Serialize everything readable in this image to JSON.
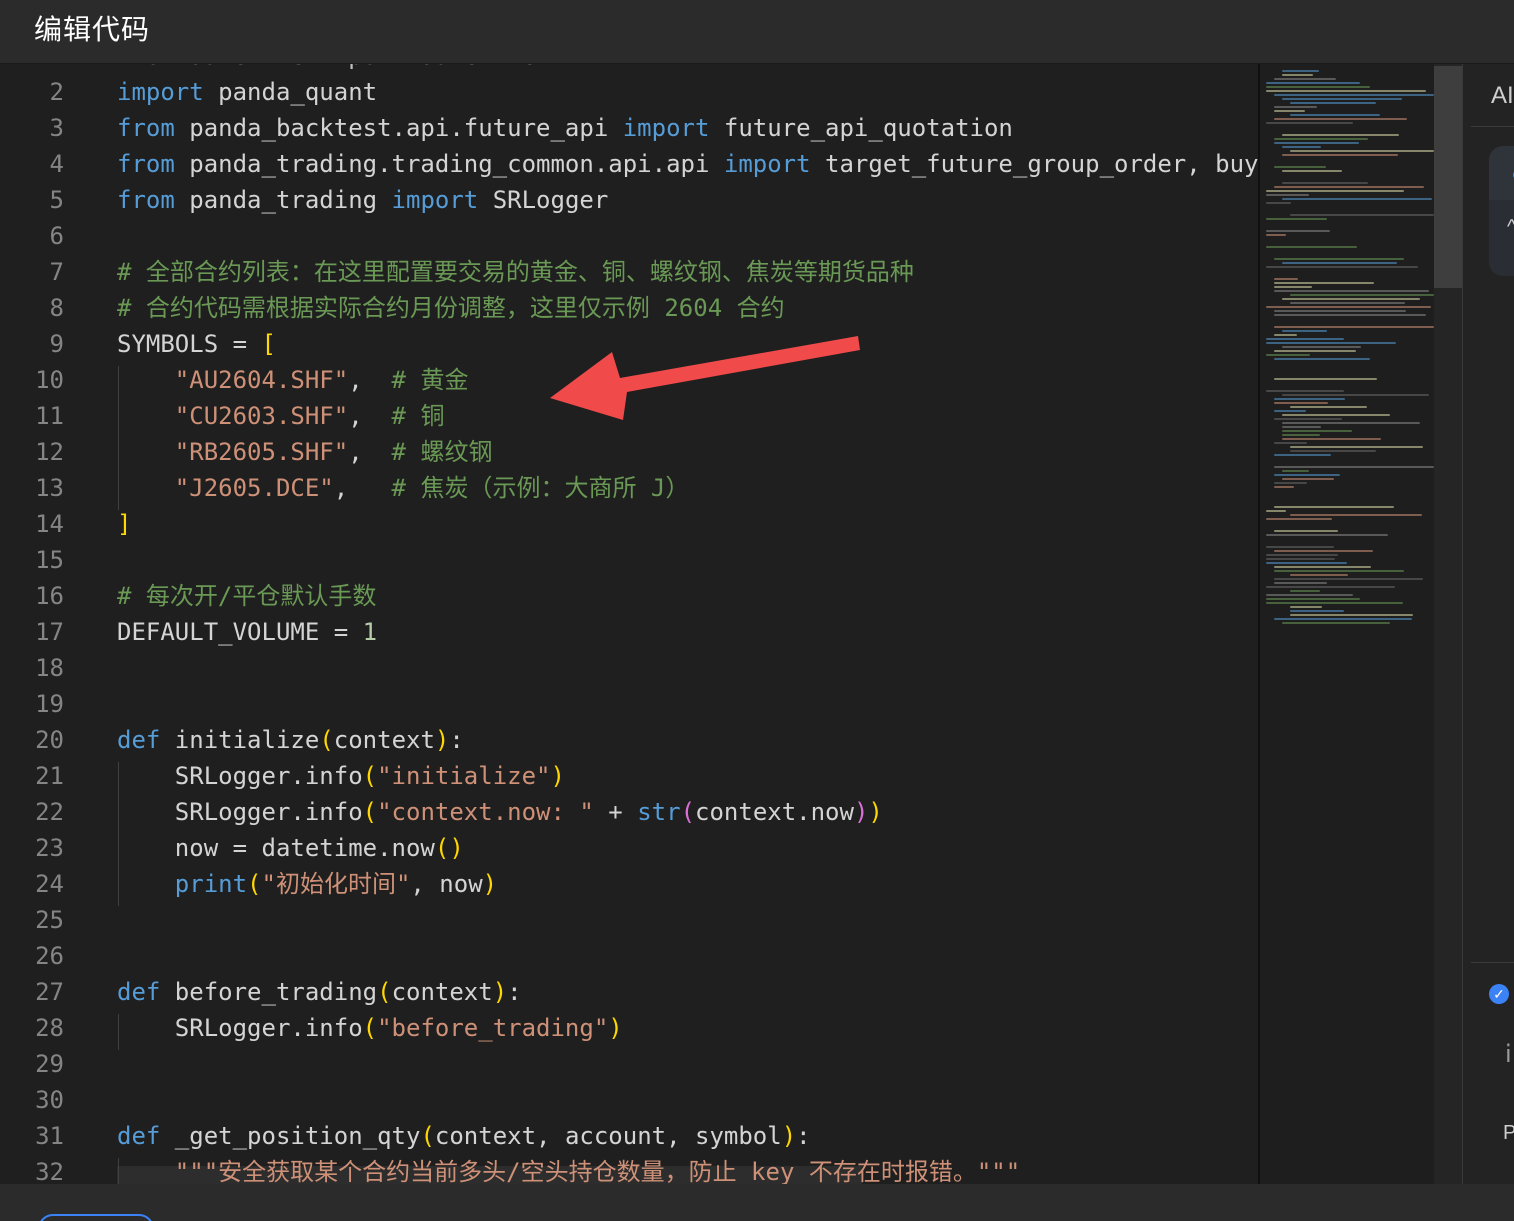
{
  "window": {
    "title": "编辑代码"
  },
  "right_panel": {
    "ai_label": "AI",
    "partial_char": "i",
    "partial_p": "P",
    "check_icon": "check-circle-icon"
  },
  "editor": {
    "partial_top_line": "from datetime import datetime",
    "lines": [
      {
        "num": "2",
        "tokens": [
          [
            "kw",
            "import"
          ],
          [
            "pun",
            " panda_quant"
          ]
        ]
      },
      {
        "num": "3",
        "tokens": [
          [
            "kw",
            "from"
          ],
          [
            "pun",
            " panda_backtest.api.future_api "
          ],
          [
            "kw",
            "import"
          ],
          [
            "pun",
            " future_api_quotation"
          ]
        ]
      },
      {
        "num": "4",
        "tokens": [
          [
            "kw",
            "from"
          ],
          [
            "pun",
            " panda_trading.trading_common.api.api "
          ],
          [
            "kw",
            "import"
          ],
          [
            "pun",
            " target_future_group_order, buy"
          ]
        ]
      },
      {
        "num": "5",
        "tokens": [
          [
            "kw",
            "from"
          ],
          [
            "pun",
            " panda_trading "
          ],
          [
            "kw",
            "import"
          ],
          [
            "pun",
            " SRLogger"
          ]
        ]
      },
      {
        "num": "6",
        "tokens": []
      },
      {
        "num": "7",
        "tokens": [
          [
            "cmt",
            "# 全部合约列表：在这里配置要交易的黄金、铜、螺纹钢、焦炭等期货品种"
          ]
        ]
      },
      {
        "num": "8",
        "tokens": [
          [
            "cmt",
            "# 合约代码需根据实际合约月份调整，这里仅示例 2604 合约"
          ]
        ]
      },
      {
        "num": "9",
        "tokens": [
          [
            "pun",
            "SYMBOLS = "
          ],
          [
            "br1",
            "["
          ]
        ]
      },
      {
        "num": "10",
        "tokens": [
          [
            "pun",
            "    "
          ],
          [
            "str",
            "\"AU2604.SHF\""
          ],
          [
            "pun",
            ",  "
          ],
          [
            "cmt",
            "# 黄金"
          ]
        ]
      },
      {
        "num": "11",
        "tokens": [
          [
            "pun",
            "    "
          ],
          [
            "str",
            "\"CU2603.SHF\""
          ],
          [
            "pun",
            ",  "
          ],
          [
            "cmt",
            "# 铜"
          ]
        ]
      },
      {
        "num": "12",
        "tokens": [
          [
            "pun",
            "    "
          ],
          [
            "str",
            "\"RB2605.SHF\""
          ],
          [
            "pun",
            ",  "
          ],
          [
            "cmt",
            "# 螺纹钢"
          ]
        ]
      },
      {
        "num": "13",
        "tokens": [
          [
            "pun",
            "    "
          ],
          [
            "str",
            "\"J2605.DCE\""
          ],
          [
            "pun",
            ",   "
          ],
          [
            "cmt",
            "# 焦炭（示例：大商所 J）"
          ]
        ]
      },
      {
        "num": "14",
        "tokens": [
          [
            "br1",
            "]"
          ]
        ]
      },
      {
        "num": "15",
        "tokens": []
      },
      {
        "num": "16",
        "tokens": [
          [
            "cmt",
            "# 每次开/平仓默认手数"
          ]
        ]
      },
      {
        "num": "17",
        "tokens": [
          [
            "pun",
            "DEFAULT_VOLUME = "
          ],
          [
            "num",
            "1"
          ]
        ]
      },
      {
        "num": "18",
        "tokens": []
      },
      {
        "num": "19",
        "tokens": []
      },
      {
        "num": "20",
        "tokens": [
          [
            "kw",
            "def"
          ],
          [
            "pun",
            " initialize"
          ],
          [
            "br1",
            "("
          ],
          [
            "pun",
            "context"
          ],
          [
            "br1",
            ")"
          ],
          [
            "pun",
            ":"
          ]
        ]
      },
      {
        "num": "21",
        "tokens": [
          [
            "pun",
            "    SRLogger.info"
          ],
          [
            "br1",
            "("
          ],
          [
            "str",
            "\"initialize\""
          ],
          [
            "br1",
            ")"
          ]
        ]
      },
      {
        "num": "22",
        "tokens": [
          [
            "pun",
            "    SRLogger.info"
          ],
          [
            "br1",
            "("
          ],
          [
            "str",
            "\"context.now: \""
          ],
          [
            "pun",
            " + "
          ],
          [
            "kw",
            "str"
          ],
          [
            "br2",
            "("
          ],
          [
            "pun",
            "context.now"
          ],
          [
            "br2",
            ")"
          ],
          [
            "br1",
            ")"
          ]
        ]
      },
      {
        "num": "23",
        "tokens": [
          [
            "pun",
            "    now = datetime.now"
          ],
          [
            "br1",
            "()"
          ]
        ]
      },
      {
        "num": "24",
        "tokens": [
          [
            "pun",
            "    "
          ],
          [
            "kw",
            "print"
          ],
          [
            "br1",
            "("
          ],
          [
            "str",
            "\"初始化时间\""
          ],
          [
            "pun",
            ", now"
          ],
          [
            "br1",
            ")"
          ]
        ]
      },
      {
        "num": "25",
        "tokens": []
      },
      {
        "num": "26",
        "tokens": []
      },
      {
        "num": "27",
        "tokens": [
          [
            "kw",
            "def"
          ],
          [
            "pun",
            " before_trading"
          ],
          [
            "br1",
            "("
          ],
          [
            "pun",
            "context"
          ],
          [
            "br1",
            ")"
          ],
          [
            "pun",
            ":"
          ]
        ]
      },
      {
        "num": "28",
        "tokens": [
          [
            "pun",
            "    SRLogger.info"
          ],
          [
            "br1",
            "("
          ],
          [
            "str",
            "\"before_trading\""
          ],
          [
            "br1",
            ")"
          ]
        ]
      },
      {
        "num": "29",
        "tokens": []
      },
      {
        "num": "30",
        "tokens": []
      },
      {
        "num": "31",
        "tokens": [
          [
            "kw",
            "def"
          ],
          [
            "pun",
            " _get_position_qty"
          ],
          [
            "br1",
            "("
          ],
          [
            "pun",
            "context, account, symbol"
          ],
          [
            "br1",
            ")"
          ],
          [
            "pun",
            ":"
          ]
        ]
      },
      {
        "num": "32",
        "tokens": [
          [
            "pun",
            "    "
          ],
          [
            "str",
            "\"\"\"安全获取某个合约当前多头/空头持仓数量，防止 key 不存在时报错。\"\"\""
          ]
        ]
      }
    ]
  },
  "colors": {
    "keyword": "#569cd6",
    "comment": "#6a9955",
    "string": "#ce9178",
    "number": "#b5cea8",
    "bracket": "#ffd700",
    "bracket_nested": "#da70d6",
    "annotation_arrow": "#f04a4a",
    "accent": "#3b82f6"
  }
}
